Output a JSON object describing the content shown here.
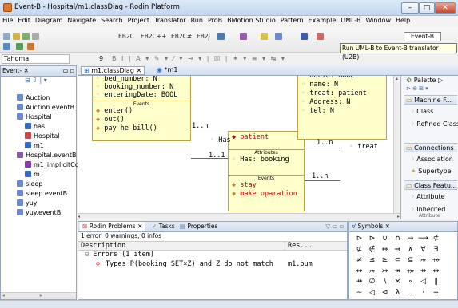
{
  "window": {
    "title": "Event-B - Hospital/m1.classDiag - Rodin Platform",
    "btn_min": "–",
    "btn_max": "□",
    "btn_close": "✕"
  },
  "menu": [
    "File",
    "Edit",
    "Diagram",
    "Navigate",
    "Search",
    "Project",
    "Translator",
    "Run",
    "ProB",
    "BMotion Studio",
    "Pattern",
    "Example",
    "UML-B",
    "Window",
    "Help"
  ],
  "toolbar": {
    "eb2c": "EB2C",
    "eb2cpp": "EB2C++",
    "eb2cs": "EB2C#",
    "eb2j": "EB2J",
    "eventb": "Event-B",
    "tooltip": "Run UML-B to Event-B translator (U2B)",
    "font": "Tahoma",
    "fontsize": "9"
  },
  "explorer": {
    "tab": "Event-",
    "items": [
      "Auction",
      "Auction.eventB",
      "Hospital",
      "has",
      "Hospital",
      "m1",
      "Hospital.eventB",
      "m1_implicitCc",
      "m1",
      "sleep",
      "sleep.eventB",
      "yuy",
      "yuy.eventB"
    ]
  },
  "editor": {
    "tab1": "m1.classDiag",
    "tab2": "*m1"
  },
  "uml": {
    "box1": {
      "attrs": [
        "bed_number: N",
        "booking_number: N",
        "enteringDate: BOOL"
      ],
      "events_hdr": "Events",
      "events": [
        "enter()",
        "out()",
        "pay he bill()"
      ]
    },
    "box2": {
      "name": "patient",
      "attrs_hdr": "Attributes",
      "attrs": [
        "Has: booking"
      ],
      "events_hdr": "Events",
      "events": [
        "stay",
        "make oparation"
      ]
    },
    "box3": {
      "attrs": [
        "docId: BOOL",
        "name: N",
        "treat: patient",
        "Address: N",
        "tel: N"
      ]
    },
    "labels": {
      "mult1": "1..n",
      "has": "Has",
      "mult2": "1..1",
      "mult3": "1..n",
      "treat": "treat",
      "mult4": "1..n"
    }
  },
  "palette": {
    "title": "Palette",
    "sec1": "Machine F...",
    "items1": [
      "Class",
      "Refined Class"
    ],
    "sec2": "Connections",
    "items2": [
      "Association",
      "Supertype"
    ],
    "sec3": "Class Featu...",
    "items3": [
      "Attribute",
      "Inherited"
    ],
    "items3_extra": "Attribute"
  },
  "problems": {
    "tab1": "Rodin Problems",
    "tab2": "Tasks",
    "tab3": "Properties",
    "summary": "1 error, 0 warnings, 0 infos",
    "col_desc": "Description",
    "col_res": "Res...",
    "group": "Errors (1 item)",
    "error": "Types P(booking_SET×Z) and Z do not match",
    "res": "m1.bum"
  },
  "symbols": {
    "tab": "Symbols",
    "rows": [
      [
        "⊳",
        "⊳",
        "∪",
        "∩",
        "↦",
        "⟶",
        "⊄"
      ],
      [
        "⊈",
        "∉",
        "⇔",
        "⇒",
        "∧",
        "∀",
        "∃"
      ],
      [
        "≠",
        "≤",
        "≥",
        "⊂",
        "⊆",
        "⤔",
        "⤀"
      ],
      [
        "↔",
        "⤖",
        "↣",
        "↠",
        "⤀",
        "⇸",
        "↔"
      ],
      [
        "⇸",
        "∅",
        "∖",
        "×",
        "∘",
        "◁",
        "∥"
      ],
      [
        "∼",
        "◁",
        "⊲",
        "λ",
        "‥",
        "·",
        "+"
      ]
    ]
  }
}
